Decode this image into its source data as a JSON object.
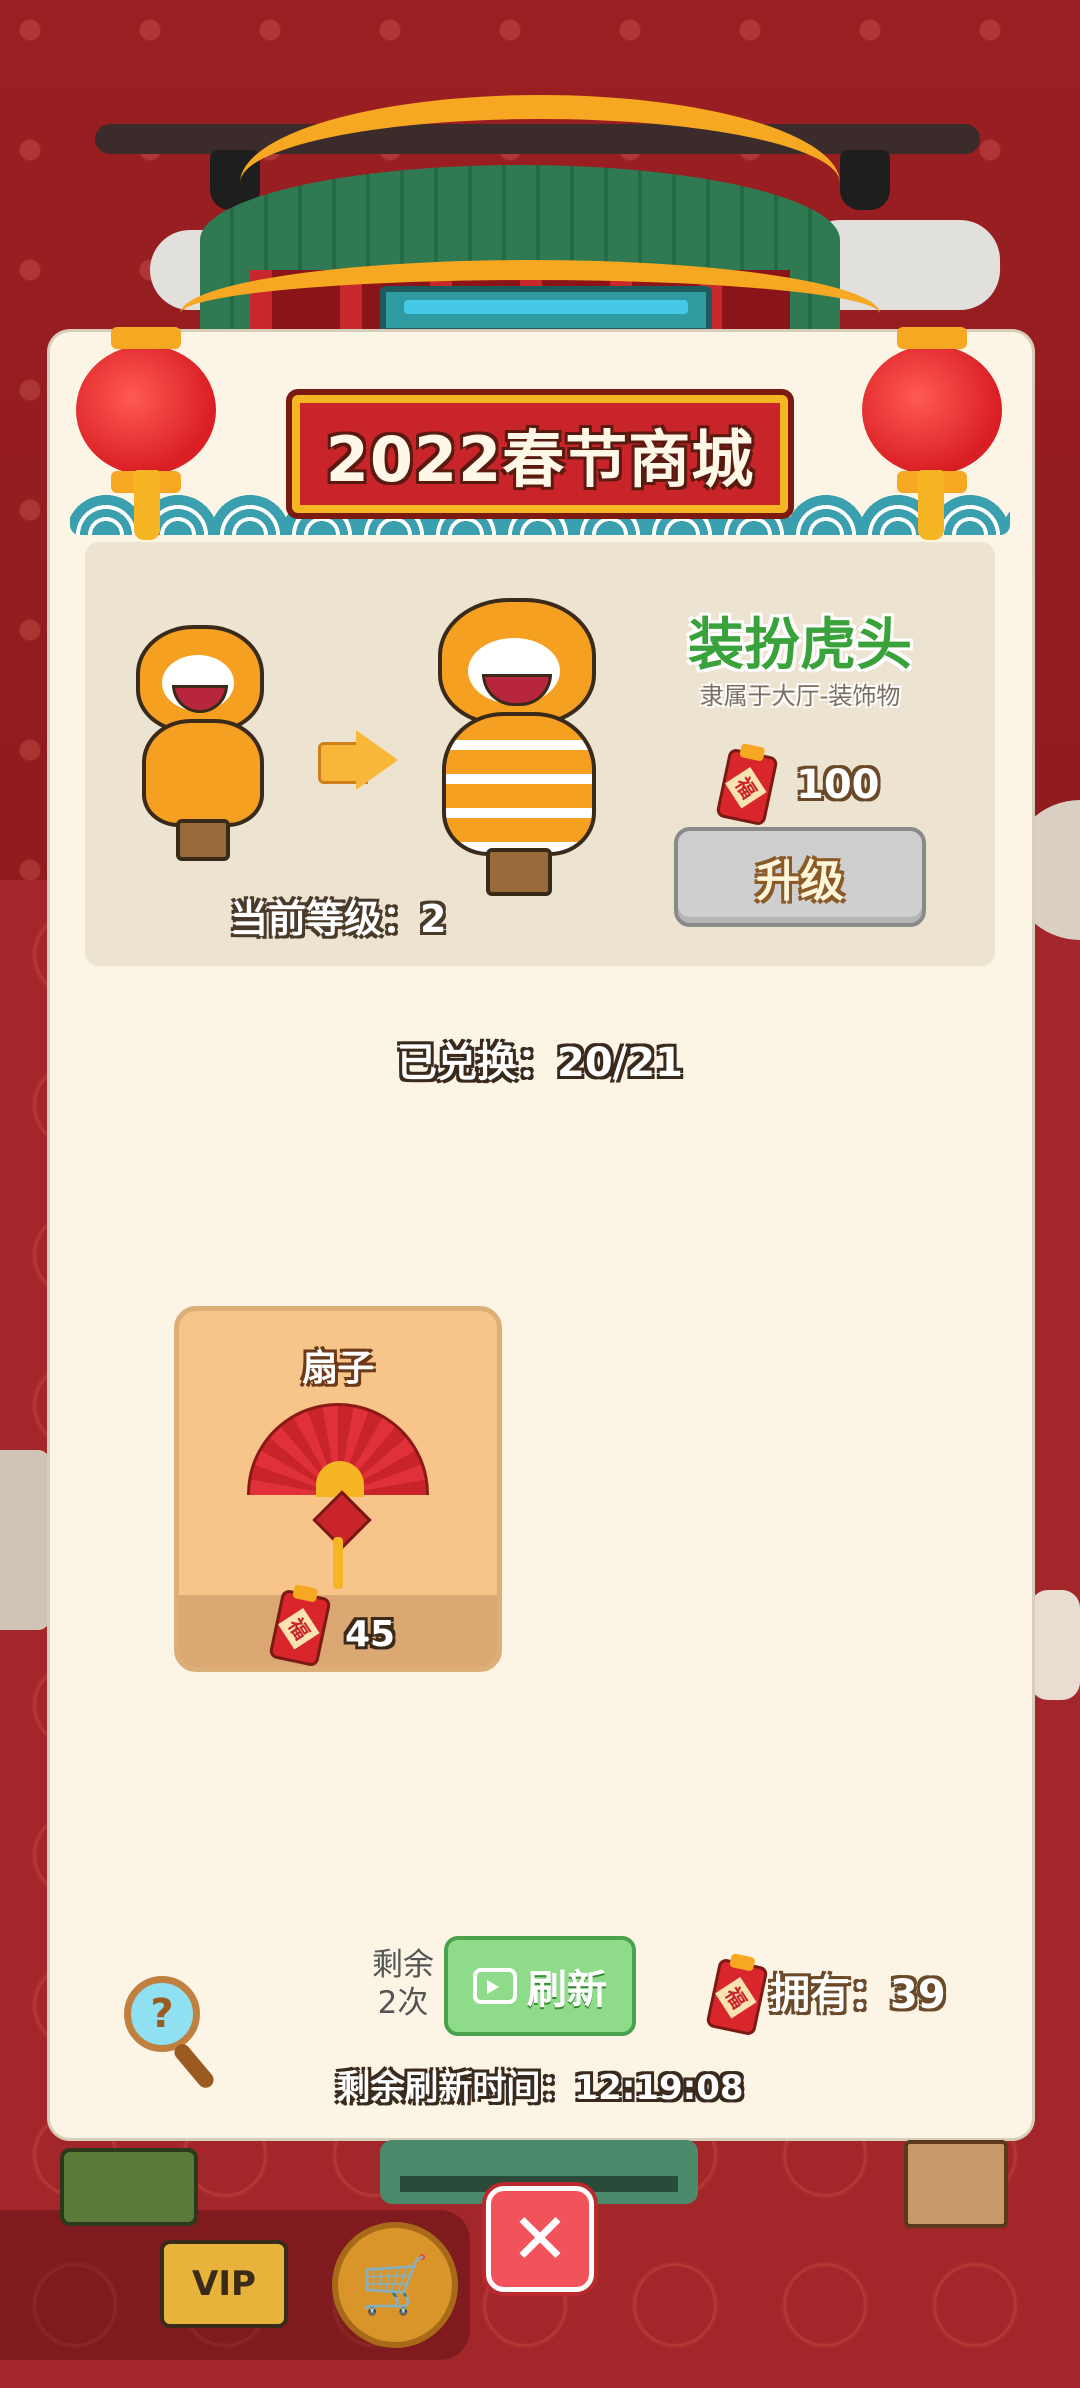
{
  "title": "2022春节商城",
  "upgrade": {
    "item_name": "装扮虎头",
    "item_subtitle": "隶属于大厅-装饰物",
    "cost": "100",
    "button_label": "升级",
    "current_level_label": "当前等级：",
    "current_level_value": "2"
  },
  "exchange": {
    "label": "已兑换：",
    "value": "20/21"
  },
  "shop_items": [
    {
      "name": "扇子",
      "price": "45",
      "icon": "fan-icon"
    }
  ],
  "refresh": {
    "remaining_label": "剩余",
    "remaining_count": "2次",
    "button_label": "刷新",
    "timer_label": "剩余刷新时间：",
    "timer_value": "12:19:08"
  },
  "owned": {
    "label": "拥有：",
    "value": "39"
  },
  "hud": {
    "vip_label": "VIP"
  },
  "colors": {
    "background": "#8e1b1e",
    "panel": "#fcf5e6",
    "title_plate": "#c8242a",
    "item_name_green": "#3aa23a",
    "refresh_button": "#8edc8a",
    "close_button": "#f2525a",
    "card": "#f7c48a"
  }
}
